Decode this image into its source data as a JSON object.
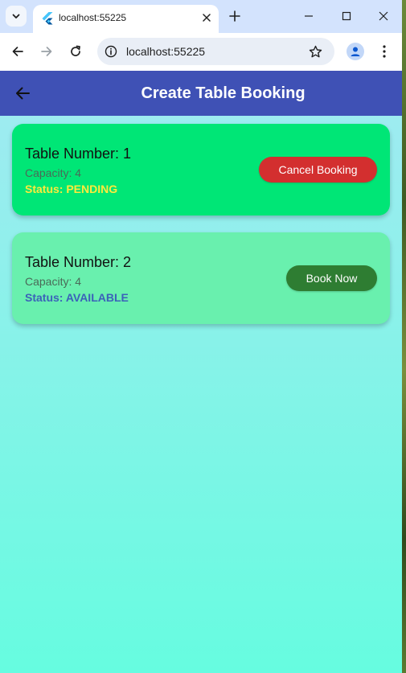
{
  "browser": {
    "tab_title": "localhost:55225",
    "url": "localhost:55225"
  },
  "app": {
    "title": "Create Table Booking"
  },
  "tables": [
    {
      "title": "Table Number: 1",
      "capacity": "Capacity: 4",
      "status": "Status: PENDING",
      "action": "Cancel Booking"
    },
    {
      "title": "Table Number: 2",
      "capacity": "Capacity: 4",
      "status": "Status: AVAILABLE",
      "action": "Book Now"
    }
  ],
  "colors": {
    "appbar": "#3f51b5",
    "card_pending": "#00e676",
    "card_available": "#69f0ae",
    "status_pending": "#ffeb3b",
    "status_available": "#3b62b9",
    "cancel_button": "#d32f2f",
    "book_button": "#2e7d32"
  }
}
